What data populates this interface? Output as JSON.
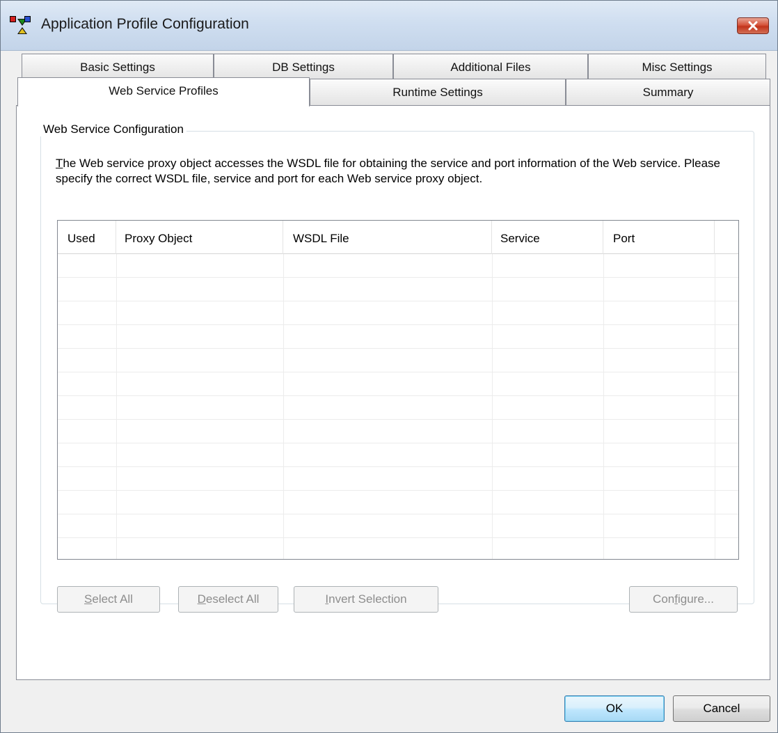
{
  "window": {
    "title": "Application Profile Configuration",
    "app_icon": "app-profile-icon",
    "close_icon": "close-icon"
  },
  "tabs": {
    "row1": [
      {
        "label": "Basic Settings"
      },
      {
        "label": "DB Settings"
      },
      {
        "label": "Additional Files"
      },
      {
        "label": "Misc Settings"
      }
    ],
    "row2": [
      {
        "label": "Web Service Profiles",
        "active": true
      },
      {
        "label": "Runtime Settings"
      },
      {
        "label": "Summary"
      }
    ]
  },
  "group": {
    "title": "Web Service Configuration",
    "description_first_letter": "T",
    "description_rest": "he Web service proxy object accesses the WSDL file for obtaining the service and port information of the Web service.  Please specify the correct WSDL file, service and port for each Web service proxy object."
  },
  "list": {
    "columns": [
      "Used",
      "Proxy Object",
      "WSDL File",
      "Service",
      "Port"
    ],
    "rows": []
  },
  "buttons": {
    "select_all": {
      "mnemonic": "S",
      "rest": "elect All",
      "enabled": false
    },
    "deselect_all": {
      "mnemonic": "D",
      "rest": "eselect All",
      "enabled": false
    },
    "invert_selection": {
      "mnemonic": "I",
      "rest": "nvert Selection",
      "enabled": false
    },
    "configure": {
      "pre": "Con",
      "mnemonic": "f",
      "rest": "igure...",
      "enabled": false
    },
    "ok": "OK",
    "cancel": "Cancel"
  },
  "colors": {
    "title_bar": "#cfdef0",
    "close_button": "#c2341b",
    "default_button": "#bee6fd"
  }
}
